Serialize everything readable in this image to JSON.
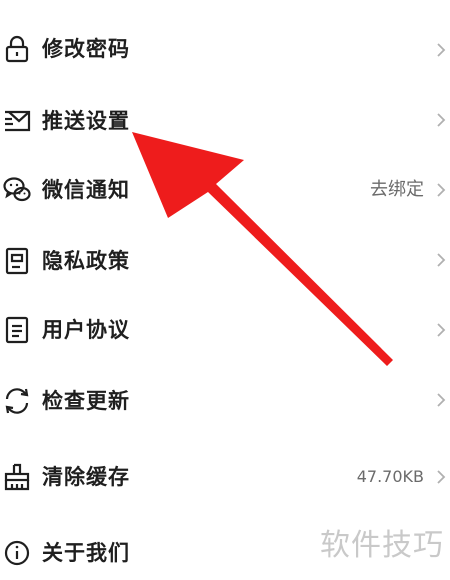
{
  "settings": {
    "items": [
      {
        "label": "修改密码",
        "icon": "lock-icon"
      },
      {
        "label": "推送设置",
        "icon": "envelope-icon"
      },
      {
        "label": "微信通知",
        "icon": "wechat-icon",
        "value": "去绑定"
      },
      {
        "label": "隐私政策",
        "icon": "privacy-doc-icon"
      },
      {
        "label": "用户协议",
        "icon": "agreement-doc-icon"
      },
      {
        "label": "检查更新",
        "icon": "refresh-icon"
      },
      {
        "label": "清除缓存",
        "icon": "broom-icon",
        "value": "47.70KB"
      },
      {
        "label": "关于我们",
        "icon": "info-icon"
      }
    ]
  },
  "watermark": "软件技巧",
  "colors": {
    "annotation_arrow": "#ee1c1c",
    "text": "#1f1f1f",
    "secondary": "#6b6b6b",
    "chevron": "#b0b0b0"
  }
}
